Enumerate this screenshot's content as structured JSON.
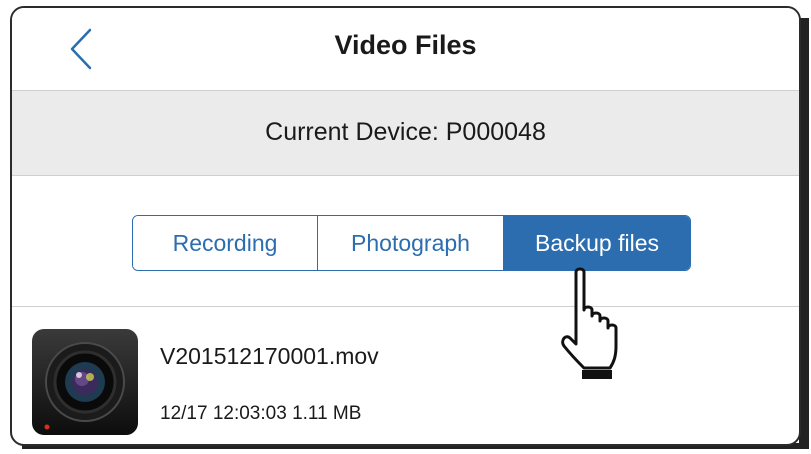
{
  "header": {
    "title": "Video Files",
    "back_icon": "chevron-left-icon"
  },
  "device": {
    "label": "Current Device: P000048"
  },
  "tabs": [
    {
      "label": "Recording",
      "active": false
    },
    {
      "label": "Photograph",
      "active": false
    },
    {
      "label": "Backup files",
      "active": true
    }
  ],
  "files": [
    {
      "name": "V201512170001.mov",
      "meta": "12/17 12:03:03  1.11 MB",
      "thumbnail_icon": "camera-lens-icon"
    }
  ],
  "colors": {
    "accent": "#2c6db0",
    "device_bar": "#ebebeb"
  },
  "overlay_icon": "pointing-hand-icon"
}
